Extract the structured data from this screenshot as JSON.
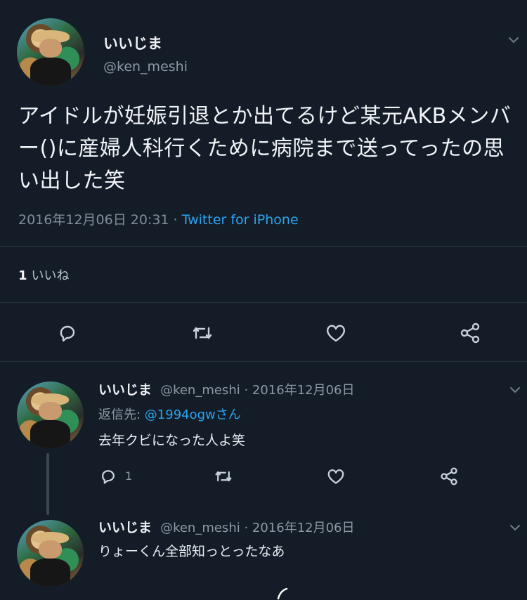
{
  "tweet": {
    "display_name": "いいじま",
    "handle": "@ken_meshi",
    "text": "アイドルが妊娠引退とか出てるけど某元AKBメンバー()に産婦人科行くために病院まで送ってったの思い出した笑",
    "date": "2016年12月06日 20:31",
    "meta_sep": " · ",
    "source": "Twitter for iPhone",
    "likes_count": "1",
    "likes_label": "いいね",
    "actions": [
      "reply-icon",
      "retweet-icon",
      "like-icon",
      "share-icon"
    ]
  },
  "replies": [
    {
      "display_name": "いいじま",
      "handle_date": "@ken_meshi · 2016年12月06日",
      "reply_to_prefix": "返信先: ",
      "reply_to_mention": "@1994ogwさん",
      "text": "去年クビになった人よ笑",
      "reply_count": "1"
    },
    {
      "display_name": "いいじま",
      "handle_date": "@ken_meshi · 2016年12月06日",
      "text": "りょーくん全部知っとったなあ"
    }
  ],
  "colors": {
    "background": "#141d27",
    "link": "#2aa3ef",
    "muted": "#8b98a5",
    "text": "#e8edf1"
  }
}
